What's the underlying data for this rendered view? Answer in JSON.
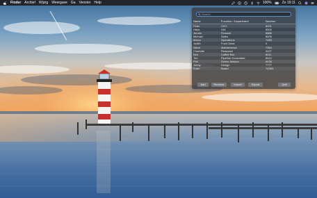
{
  "menubar": {
    "items": [
      "Finder",
      "Archief",
      "Wijzig",
      "Weergave",
      "Ga",
      "Venster",
      "Help"
    ],
    "battery_text": "100%",
    "clock": "Zo 19:11"
  },
  "search": {
    "placeholder": "Search"
  },
  "table": {
    "columns": [
      "Name",
      "Function / Department",
      "Number"
    ],
    "rows": [
      [
        "Peter",
        "CEO",
        "8001"
      ],
      [
        "Hans",
        "GM",
        "8002"
      ],
      [
        "Jeroen",
        "Finance",
        "8888"
      ],
      [
        "Michael",
        "Sales",
        "8009"
      ],
      [
        "Marco",
        "Operations",
        "7465"
      ],
      [
        "Judith",
        "Front Desk",
        "0"
      ],
      [
        "Steve",
        "Maintenance",
        "7364"
      ],
      [
        "Charlotte",
        "Research",
        "3427"
      ],
      [
        "Kim",
        "Coffee Bar",
        "8011"
      ],
      [
        "Tim",
        "Pipeline Consultant",
        "8412"
      ],
      [
        "Phil",
        "Senior Advisor",
        "6438"
      ],
      [
        "Johny",
        "Design",
        "7777"
      ],
      [
        "Koen",
        "Board",
        "74383"
      ]
    ]
  },
  "buttons": {
    "add": "Add",
    "remove": "Remove",
    "import": "Import",
    "export": "Export",
    "quit": "Quit"
  }
}
